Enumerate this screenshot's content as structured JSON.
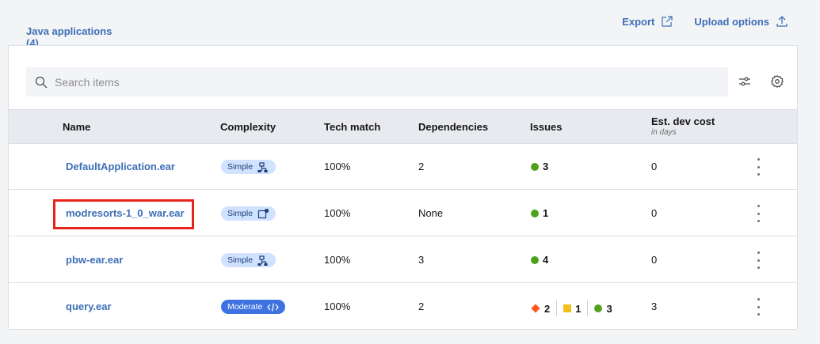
{
  "tabs": [
    {
      "label": "Java applications (4)",
      "selected": true
    }
  ],
  "actions": {
    "export_label": "Export",
    "upload_label": "Upload options"
  },
  "search": {
    "placeholder": "Search items",
    "value": ""
  },
  "columns": {
    "name": "Name",
    "complexity": "Complexity",
    "tech_match": "Tech match",
    "dependencies": "Dependencies",
    "issues": "Issues",
    "cost": "Est. dev cost",
    "cost_sub": "in days"
  },
  "rows": [
    {
      "name": "DefaultApplication.ear",
      "complexity": "Simple",
      "complexity_icon": "flow-icon",
      "tech_match": "100%",
      "dependencies": "2",
      "issues": {
        "green": "3"
      },
      "cost": "0"
    },
    {
      "name": "modresorts-1_0_war.ear",
      "complexity": "Simple",
      "complexity_icon": "launch-badge-icon",
      "tech_match": "100%",
      "dependencies": "None",
      "issues": {
        "green": "1"
      },
      "cost": "0"
    },
    {
      "name": "pbw-ear.ear",
      "complexity": "Simple",
      "complexity_icon": "flow-icon",
      "tech_match": "100%",
      "dependencies": "3",
      "issues": {
        "green": "4"
      },
      "cost": "0"
    },
    {
      "name": "query.ear",
      "complexity": "Moderate",
      "complexity_icon": "code-icon",
      "tech_match": "100%",
      "dependencies": "2",
      "issues": {
        "critical": "2",
        "warning": "1",
        "green": "3"
      },
      "cost": "3"
    }
  ],
  "colors": {
    "accent": "#3d6fb6",
    "tag_simple_bg": "#d0e2ff",
    "tag_moderate_bg": "#3d72e0",
    "issue_green": "#4ea11d",
    "issue_critical": "#ff5a1f",
    "issue_warning": "#f1c21b",
    "highlight": "#e8231a"
  }
}
